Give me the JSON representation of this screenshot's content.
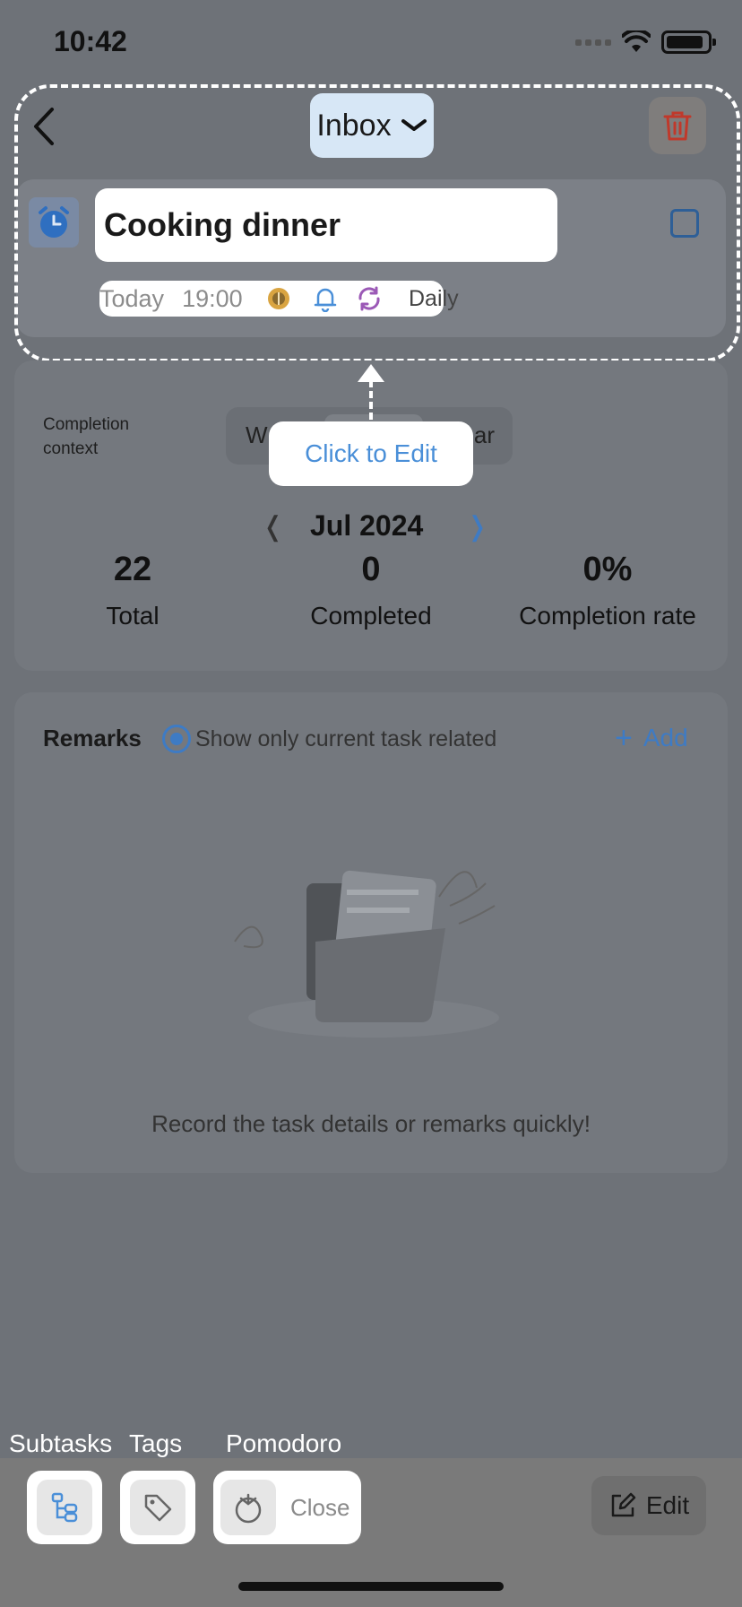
{
  "status_bar": {
    "time": "10:42"
  },
  "header": {
    "project": "Inbox"
  },
  "task": {
    "title": "Cooking dinner",
    "date": "Today",
    "time": "19:00",
    "repeat": "Daily"
  },
  "tooltip": {
    "text": "Click to Edit"
  },
  "completion": {
    "context_label": "Completion context",
    "segment_left": "W",
    "segment_right": "ar",
    "month": "Jul 2024",
    "prev": "❬",
    "next": "❭",
    "stats": [
      {
        "value": "22",
        "label": "Total"
      },
      {
        "value": "0",
        "label": "Completed"
      },
      {
        "value": "0%",
        "label": "Completion rate"
      }
    ]
  },
  "remarks": {
    "title": "Remarks",
    "filter_label": "Show only current task related",
    "add_label": "Add",
    "empty_text": "Record the task details or remarks quickly!"
  },
  "toolbar": {
    "subtasks_label": "Subtasks",
    "tags_label": "Tags",
    "pomodoro_label": "Pomodoro",
    "pomodoro_state": "Close",
    "edit_label": "Edit"
  },
  "colors": {
    "accent": "#3e7bc4",
    "overlay": "#6e7278",
    "delete": "#d9534f"
  }
}
